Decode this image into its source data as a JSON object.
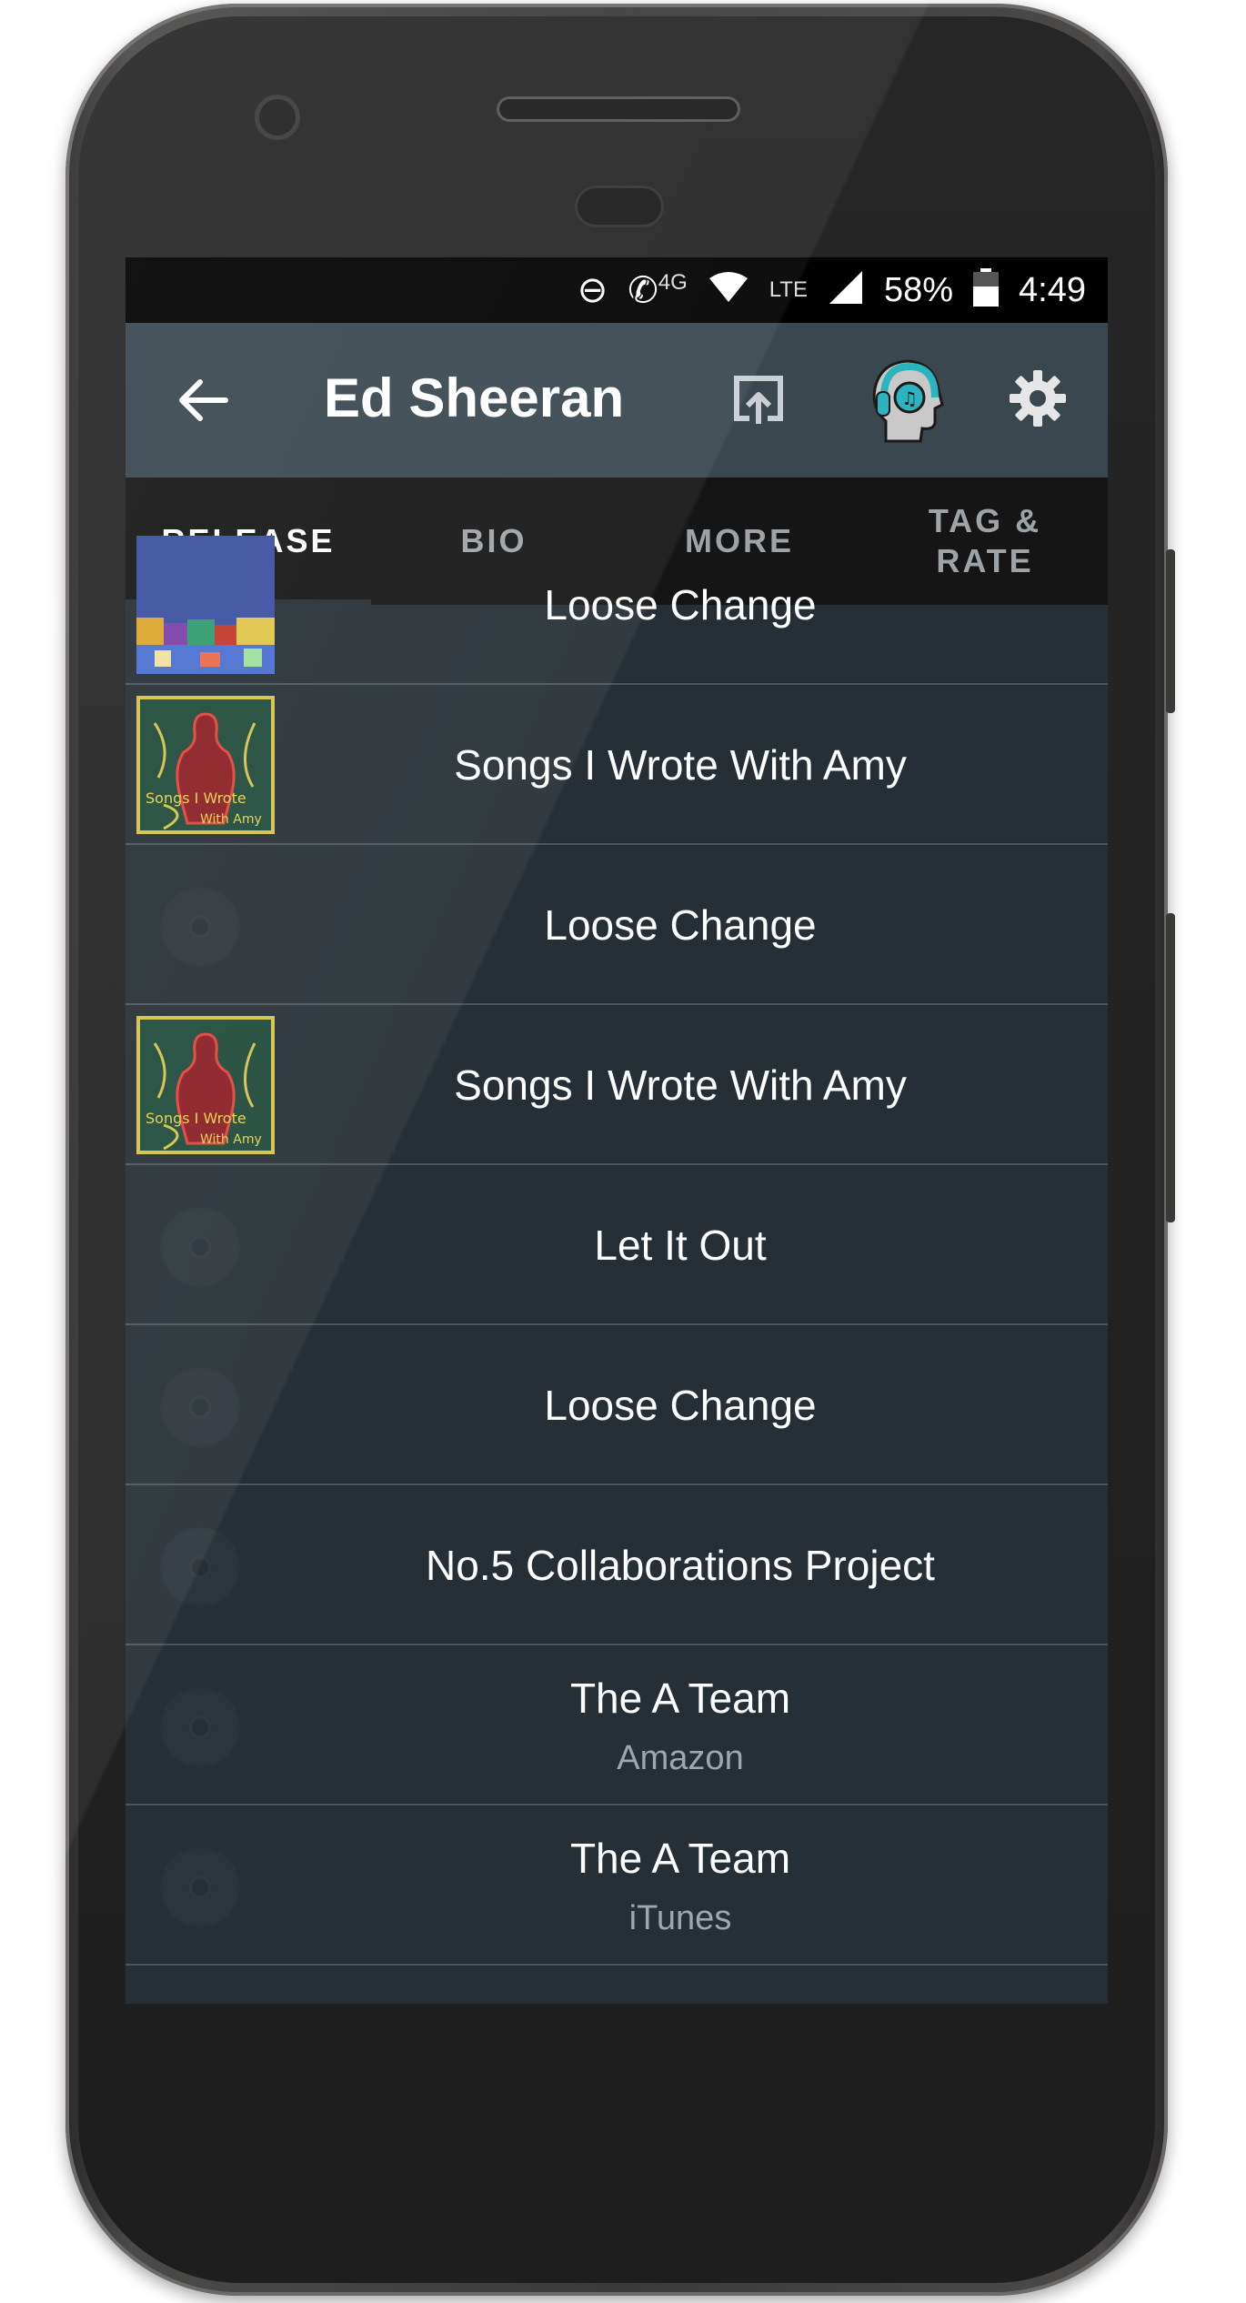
{
  "status_bar": {
    "battery": "58%",
    "time": "4:49",
    "network": "LTE",
    "call_network": "4G"
  },
  "app_bar": {
    "title": "Ed Sheeran"
  },
  "tabs": [
    {
      "label": "RELEASE",
      "active": true
    },
    {
      "label": "BIO",
      "active": false
    },
    {
      "label": "MORE",
      "active": false
    },
    {
      "label": "TAG &\nRATE",
      "active": false
    }
  ],
  "releases": [
    {
      "title": "Loose Change",
      "subtitle": "",
      "artwork": "collage-art"
    },
    {
      "title": "Songs I Wrote With Amy",
      "subtitle": "",
      "artwork": "amy-art"
    },
    {
      "title": "Loose Change",
      "subtitle": "",
      "artwork": "disc-placeholder"
    },
    {
      "title": "Songs I Wrote With Amy",
      "subtitle": "",
      "artwork": "amy-art"
    },
    {
      "title": "Let It Out",
      "subtitle": "",
      "artwork": "disc-placeholder"
    },
    {
      "title": "Loose Change",
      "subtitle": "",
      "artwork": "disc-placeholder"
    },
    {
      "title": "No.5 Collaborations Project",
      "subtitle": "",
      "artwork": "disc-placeholder"
    },
    {
      "title": "The A Team",
      "subtitle": "Amazon",
      "artwork": "disc-placeholder"
    },
    {
      "title": "The A Team",
      "subtitle": "iTunes",
      "artwork": "disc-placeholder"
    }
  ],
  "colors": {
    "screen_bg": "#262f35",
    "app_bar_bg": "#3a474f",
    "tabs_bg": "#151515",
    "accent_teal": "#2bb3c0"
  }
}
